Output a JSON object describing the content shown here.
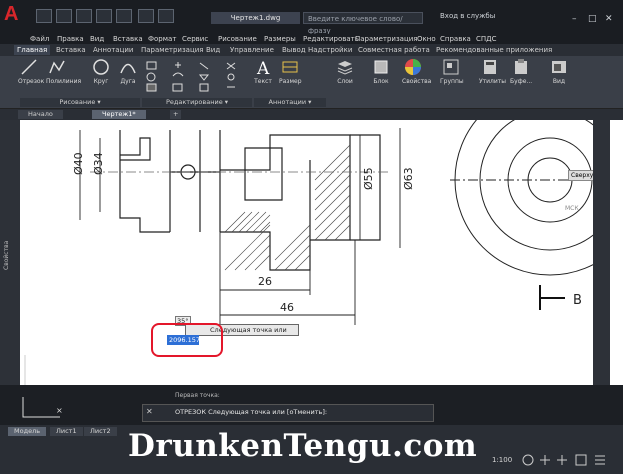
{
  "title_bar": {
    "logo": "A",
    "doc_title": "Чертеж1.dwg",
    "search_placeholder": "Введите ключевое слово/фразу",
    "login": "Вход в службы",
    "window_controls": [
      "–",
      "□",
      "✕"
    ]
  },
  "menu": [
    "Файл",
    "Правка",
    "Вид",
    "Вставка",
    "Формат",
    "Сервис",
    "Рисование",
    "Размеры",
    "Редактировать",
    "Параметризация",
    "Окно",
    "Справка",
    "СПДС"
  ],
  "ribbon_tabs": [
    "Главная",
    "Вставка",
    "Аннотации",
    "Параметризация",
    "Вид",
    "Управление",
    "Вывод",
    "Надстройки",
    "Совместная работа",
    "Рекомендованные приложения"
  ],
  "tools": [
    {
      "label": "Отрезок",
      "icon": "line-icon"
    },
    {
      "label": "Полилиния",
      "icon": "polyline-icon"
    },
    {
      "label": "Круг",
      "icon": "circle-icon"
    },
    {
      "label": "Дуга",
      "icon": "arc-icon"
    },
    {
      "label": "Текст",
      "icon": "text-icon"
    },
    {
      "label": "Размер",
      "icon": "dimension-icon"
    },
    {
      "label": "Слои",
      "icon": "layers-icon"
    },
    {
      "label": "Блок",
      "icon": "block-icon"
    },
    {
      "label": "Свойства",
      "icon": "properties-icon"
    },
    {
      "label": "Группы",
      "icon": "groups-icon"
    },
    {
      "label": "Утилиты",
      "icon": "utilities-icon"
    },
    {
      "label": "Буфе...",
      "icon": "clipboard-icon"
    },
    {
      "label": "Вид",
      "icon": "view-icon"
    }
  ],
  "panels": [
    "Рисование ▾",
    "Редактирование ▾",
    "Аннотации ▾"
  ],
  "doc_tabs": [
    "Начало",
    "Чертеж1*",
    "+"
  ],
  "drawing": {
    "dim_40": "Ø40",
    "dim_34": "Ø34",
    "dim_55": "Ø55",
    "dim_63": "Ø63",
    "dim_26": "26",
    "dim_46": "46",
    "section": "B",
    "view_label": "Сверху",
    "orbit_label": "МСК"
  },
  "leftbar_label": "Свойства",
  "prompt": {
    "label": "Следующая точка или",
    "input_value": "2096.1572",
    "angle": "35°"
  },
  "command": {
    "history": "Первая точка:",
    "text": "ОТРЕЗОК Следующая точка или [оТменить]:"
  },
  "layout_tabs": [
    "Модель",
    "Лист1",
    "Лист2"
  ],
  "status": {
    "scale": "1:100"
  },
  "watermark": "DrunkenTengu.com"
}
